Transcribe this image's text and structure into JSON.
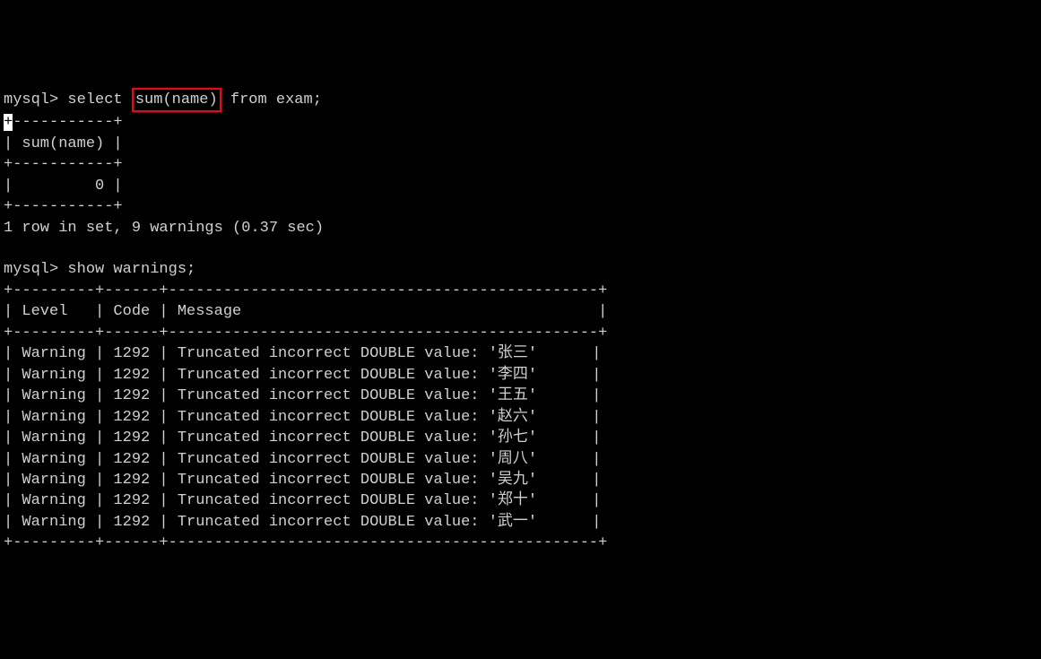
{
  "query1": {
    "prompt": "mysql>",
    "sql_before": " select ",
    "sql_highlighted": "sum(name)",
    "sql_after": " from exam;"
  },
  "result1": {
    "border_top": "+-----------+",
    "header": "| sum(name) |",
    "border_mid": "+-----------+",
    "data_row": "|         0 |",
    "border_bottom": "+-----------+",
    "status": "1 row in set, 9 warnings (0.37 sec)"
  },
  "query2": {
    "prompt": "mysql>",
    "sql": " show warnings;"
  },
  "warnings_table": {
    "border_top": "+---------+------+-----------------------------------------------+",
    "header": "| Level   | Code | Message                                       |",
    "border_mid": "+---------+------+-----------------------------------------------+",
    "rows": [
      "| Warning | 1292 | Truncated incorrect DOUBLE value: '张三'      |",
      "| Warning | 1292 | Truncated incorrect DOUBLE value: '李四'      |",
      "| Warning | 1292 | Truncated incorrect DOUBLE value: '王五'      |",
      "| Warning | 1292 | Truncated incorrect DOUBLE value: '赵六'      |",
      "| Warning | 1292 | Truncated incorrect DOUBLE value: '孙七'      |",
      "| Warning | 1292 | Truncated incorrect DOUBLE value: '周八'      |",
      "| Warning | 1292 | Truncated incorrect DOUBLE value: '吴九'      |",
      "| Warning | 1292 | Truncated incorrect DOUBLE value: '郑十'      |",
      "| Warning | 1292 | Truncated incorrect DOUBLE value: '武一'      |"
    ],
    "border_bottom": "+---------+------+-----------------------------------------------+"
  },
  "chart_data": {
    "type": "table",
    "title": "show warnings",
    "columns": [
      "Level",
      "Code",
      "Message"
    ],
    "rows": [
      [
        "Warning",
        1292,
        "Truncated incorrect DOUBLE value: '张三'"
      ],
      [
        "Warning",
        1292,
        "Truncated incorrect DOUBLE value: '李四'"
      ],
      [
        "Warning",
        1292,
        "Truncated incorrect DOUBLE value: '王五'"
      ],
      [
        "Warning",
        1292,
        "Truncated incorrect DOUBLE value: '赵六'"
      ],
      [
        "Warning",
        1292,
        "Truncated incorrect DOUBLE value: '孙七'"
      ],
      [
        "Warning",
        1292,
        "Truncated incorrect DOUBLE value: '周八'"
      ],
      [
        "Warning",
        1292,
        "Truncated incorrect DOUBLE value: '吴九'"
      ],
      [
        "Warning",
        1292,
        "Truncated incorrect DOUBLE value: '郑十'"
      ],
      [
        "Warning",
        1292,
        "Truncated incorrect DOUBLE value: '武一'"
      ]
    ]
  }
}
